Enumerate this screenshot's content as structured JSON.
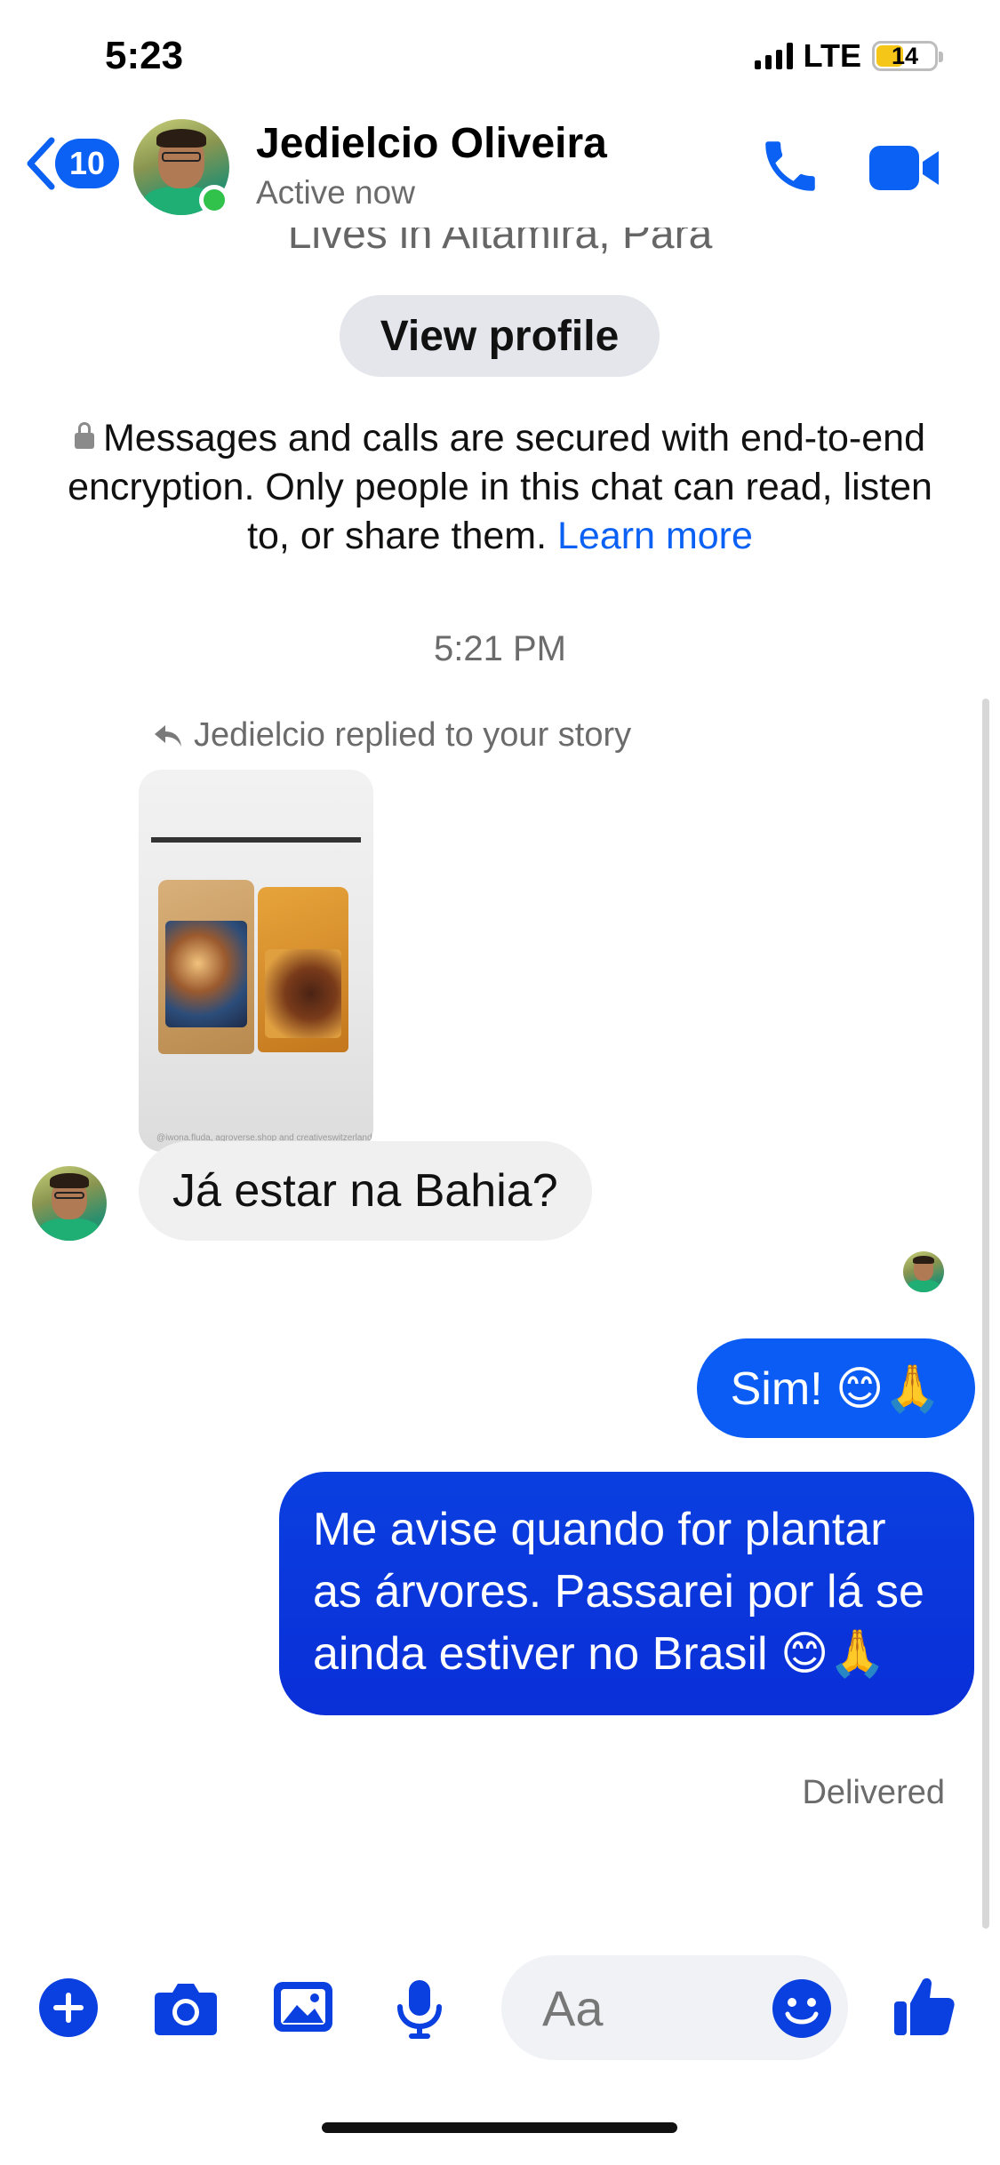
{
  "status_bar": {
    "time": "5:23",
    "network": "LTE",
    "battery": "14"
  },
  "header": {
    "back_count": "10",
    "name": "Jedielcio Oliveira",
    "status": "Active now",
    "icons": {
      "back": "chevron-left-icon",
      "call": "phone-icon",
      "video": "video-camera-icon"
    },
    "accent_color": "#0a61f3"
  },
  "intro": {
    "lives_in": "Lives in Altamira, Para",
    "view_profile_label": "View profile",
    "encryption_text": "Messages and calls are secured with end-to-end encryption. Only people in this chat can read, listen to, or share them.",
    "learn_more": "Learn more"
  },
  "conversation": {
    "timestamp": "5:21 PM",
    "reply_label": "Jedielcio replied to your story",
    "story_credit": "@iwona.fluda, agroverse.shop and creativeswitzerland",
    "messages": [
      {
        "from": "them",
        "text": "Já estar na Bahia?"
      },
      {
        "from": "me",
        "text": "Sim! 😊🙏"
      },
      {
        "from": "me",
        "text": "Me avise quando for plantar as árvores. Passarei por lá se ainda estiver no Brasil 😊🙏"
      }
    ],
    "delivery_status": "Delivered"
  },
  "composer": {
    "placeholder": "Aa",
    "icons": [
      "plus-icon",
      "camera-icon",
      "image-icon",
      "microphone-icon",
      "emoji-icon",
      "thumbs-up-icon"
    ]
  }
}
